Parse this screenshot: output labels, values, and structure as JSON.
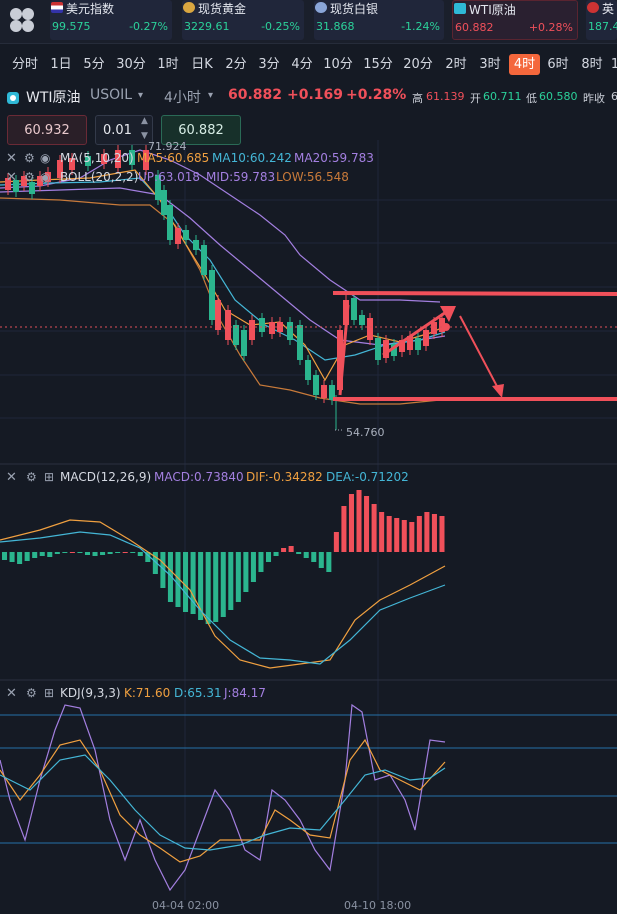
{
  "tickers": [
    {
      "name": "美元指数",
      "price": "99.575",
      "change": "-0.27%",
      "flag": "us-flag-icon",
      "color": "#2bd19a"
    },
    {
      "name": "现货黄金",
      "price": "3229.61",
      "change": "-0.25%",
      "flag": "gold-icon",
      "color": "#2bd19a"
    },
    {
      "name": "现货白银",
      "price": "31.868",
      "change": "-1.24%",
      "flag": "silver-icon",
      "color": "#2bd19a"
    },
    {
      "name": "WTI原油",
      "price": "60.882",
      "change": "+0.28%",
      "flag": "oil-icon",
      "color": "#f0505a"
    },
    {
      "name": "英",
      "price": "187.4",
      "change": "",
      "flag": "uk-flag-icon",
      "color": "#2bd19a"
    }
  ],
  "timeframes": [
    "分时",
    "1日",
    "5分",
    "30分",
    "1时",
    "日K",
    "2分",
    "3分",
    "4分",
    "10分",
    "15分",
    "20分",
    "2时",
    "3时",
    "4时",
    "6时",
    "8时",
    "1"
  ],
  "active_timeframe": "4时",
  "symbol": {
    "name": "WTI原油",
    "code": "USOIL",
    "interval": "4小时",
    "price": "60.882",
    "change": "+0.169",
    "change_pct": "+0.28%",
    "high_label": "高",
    "high": "61.139",
    "open_label": "开",
    "open": "60.711",
    "low_label": "低",
    "low": "60.580",
    "prev_label": "昨收",
    "prev": "6"
  },
  "order": {
    "sell_price": "60.932",
    "qty": "0.01",
    "buy_price": "60.882"
  },
  "indicators": {
    "ma": {
      "title": "MA(5,10,20)",
      "ma5": "MA5:60.685",
      "ma10": "MA10:60.242",
      "ma20": "MA20:59.783"
    },
    "boll": {
      "title": "BOLL(20,2,2)",
      "up": "UP:63.018",
      "mid": "MID:59.783",
      "low": "LOW:56.548"
    },
    "macd": {
      "title": "MACD(12,26,9)",
      "macd": "MACD:0.73840",
      "dif": "DIF:-0.34282",
      "dea": "DEA:-0.71202"
    },
    "kdj": {
      "title": "KDJ(9,3,3)",
      "k": "K:71.60",
      "d": "D:65.31",
      "j": "J:84.17"
    }
  },
  "annotations": {
    "high_mark": "71.924",
    "low_mark": "54.760"
  },
  "time_labels": [
    "04-04 02:00",
    "04-10 18:00"
  ],
  "colors": {
    "up": "#f0505a",
    "down": "#2bb58e",
    "accent": "#f4673c",
    "ma5": "#f0a040",
    "ma10": "#44b6d6",
    "ma20": "#a37fe0",
    "boll_low": "#c87a3a"
  }
}
